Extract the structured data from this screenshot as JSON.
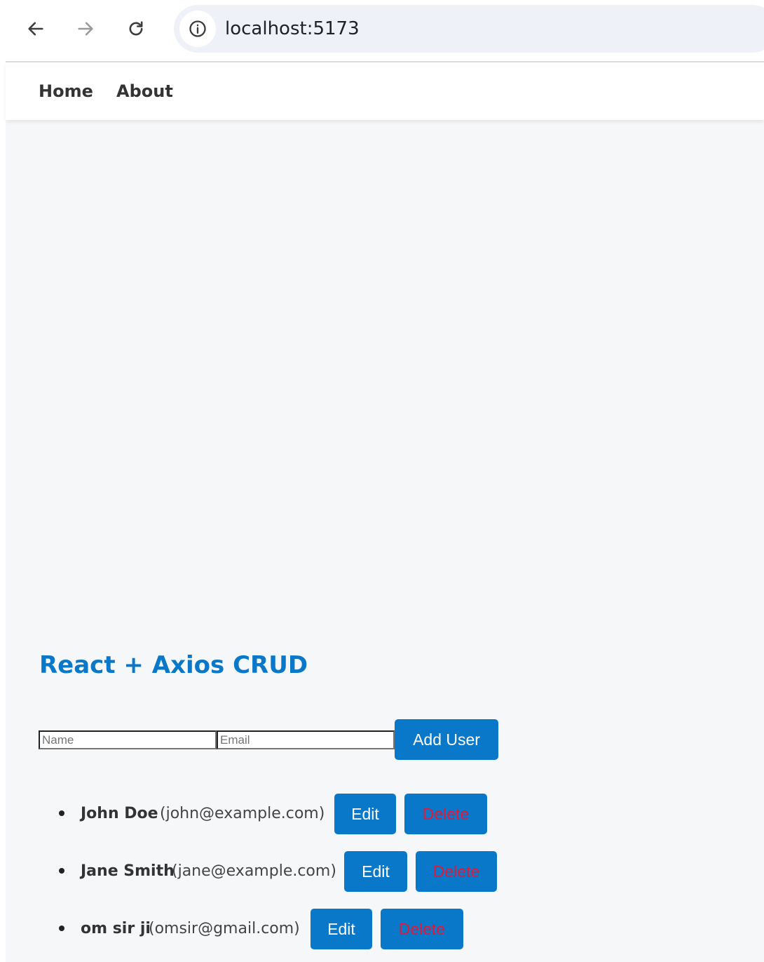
{
  "browser": {
    "url": "localhost:5173",
    "back_icon": "arrow-left-icon",
    "forward_icon": "arrow-right-icon",
    "reload_icon": "reload-icon",
    "site_info_icon": "info-icon"
  },
  "nav": {
    "links": [
      {
        "label": "Home"
      },
      {
        "label": "About"
      }
    ]
  },
  "page": {
    "title": "React + Axios CRUD"
  },
  "form": {
    "name_placeholder": "Name",
    "name_value": "",
    "email_placeholder": "Email",
    "email_value": "",
    "add_label": "Add User"
  },
  "users": [
    {
      "name": "John Doe",
      "email": "(john@example.com)",
      "edit_label": "Edit",
      "delete_label": "Delete"
    },
    {
      "name": "Jane Smith",
      "email": "(jane@example.com)",
      "edit_label": "Edit",
      "delete_label": "Delete"
    },
    {
      "name": "om sir ji",
      "email": "(omsir@gmail.com)",
      "edit_label": "Edit",
      "delete_label": "Delete"
    }
  ],
  "colors": {
    "accent": "#0a78c8",
    "delete_text": "#e0193c",
    "background": "#f5f7f9"
  }
}
